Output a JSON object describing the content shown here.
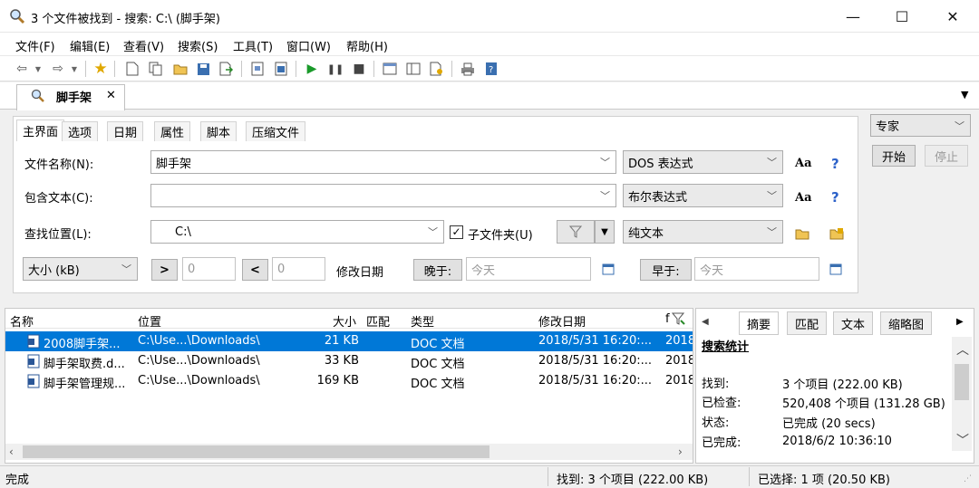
{
  "window": {
    "title": "3 个文件被找到 - 搜索: C:\\ (脚手架)",
    "minimize": "—",
    "maximize": "☐",
    "close": "✕"
  },
  "menu": [
    "文件(F)",
    "编辑(E)",
    "查看(V)",
    "搜索(S)",
    "工具(T)",
    "窗口(W)",
    "帮助(H)"
  ],
  "doc_tab": {
    "label": "脚手架",
    "close": "✕"
  },
  "panel_tabs": [
    "主界面",
    "选项",
    "日期",
    "属性",
    "脚本",
    "压缩文件"
  ],
  "form": {
    "filename_label": "文件名称(N):",
    "filename_value": "脚手架",
    "filename_mode": "DOS 表达式",
    "content_label": "包含文本(C):",
    "content_value": "",
    "content_mode": "布尔表达式",
    "location_label": "查找位置(L):",
    "location_value": "C:\\",
    "subfolders_label": "子文件夹(U)",
    "text_mode": "纯文本",
    "size_unit": "大小 (kB)",
    "gt": ">",
    "lt": "<",
    "size_min": "0",
    "size_max": "0",
    "modified_label": "修改日期",
    "later_label": "晚于:",
    "later_value": "今天",
    "earlier_label": "早于:",
    "earlier_value": "今天",
    "aa": "Aa",
    "help": "?"
  },
  "right_controls": {
    "mode": "专家",
    "start": "开始",
    "stop": "停止"
  },
  "results": {
    "columns": [
      "名称",
      "位置",
      "大小",
      "匹配",
      "类型",
      "修改日期",
      "f"
    ],
    "rows": [
      {
        "name": "2008脚手架...",
        "location": "C:\\Use...\\Downloads\\",
        "size": "21 KB",
        "type": "DOC 文档",
        "modified": "2018/5/31 16:20:...",
        "extra": "2018"
      },
      {
        "name": "脚手架取费.d...",
        "location": "C:\\Use...\\Downloads\\",
        "size": "33 KB",
        "type": "DOC 文档",
        "modified": "2018/5/31 16:20:...",
        "extra": "2018"
      },
      {
        "name": "脚手架管理规...",
        "location": "C:\\Use...\\Downloads\\",
        "size": "169 KB",
        "type": "DOC 文档",
        "modified": "2018/5/31 16:20:...",
        "extra": "2018"
      }
    ]
  },
  "side": {
    "tabs": [
      "摘要",
      "匹配",
      "文本",
      "缩略图"
    ],
    "heading": "搜索统计",
    "stats": [
      {
        "k": "找到:",
        "v": "3 个项目  (222.00 KB)"
      },
      {
        "k": "已检查:",
        "v": "520,408 个项目  (131.28 GB)"
      },
      {
        "k": "状态:",
        "v": "已完成  (20 secs)"
      },
      {
        "k": "已完成:",
        "v": "2018/6/2 10:36:10"
      }
    ]
  },
  "status": {
    "left": "完成",
    "found": "找到: 3 个项目 (222.00 KB)",
    "selected": "已选择: 1 项 (20.50 KB)"
  }
}
